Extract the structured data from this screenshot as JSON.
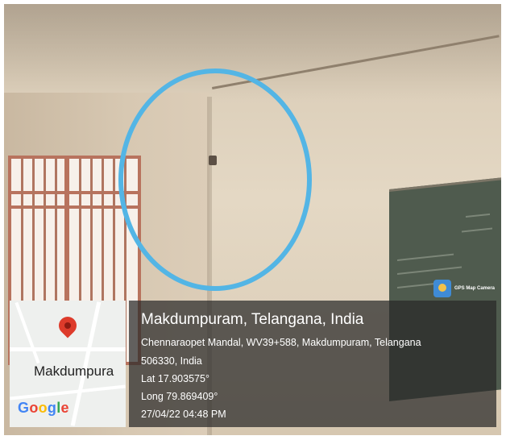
{
  "overlay": {
    "title": "Makdumpuram, Telangana, India",
    "address_line1": "Chennaraopet Mandal, WV39+588, Makdumpuram, Telangana",
    "address_line2": "506330, India",
    "lat": "Lat 17.903575°",
    "long": "Long 79.869409°",
    "datetime": "27/04/22 04:48 PM"
  },
  "map": {
    "place_label": "Makdumpura",
    "brand": [
      "G",
      "o",
      "o",
      "g",
      "l",
      "e"
    ],
    "brand_colors": [
      "#4285F4",
      "#EA4335",
      "#FBBC05",
      "#4285F4",
      "#34A853",
      "#EA4335"
    ],
    "pin_color": "#DD3B2B"
  },
  "badge": {
    "label": "GPS Map Camera",
    "icon": "gps-map-camera-icon"
  },
  "annotation": {
    "shape": "circle",
    "color": "#53B5E5"
  }
}
